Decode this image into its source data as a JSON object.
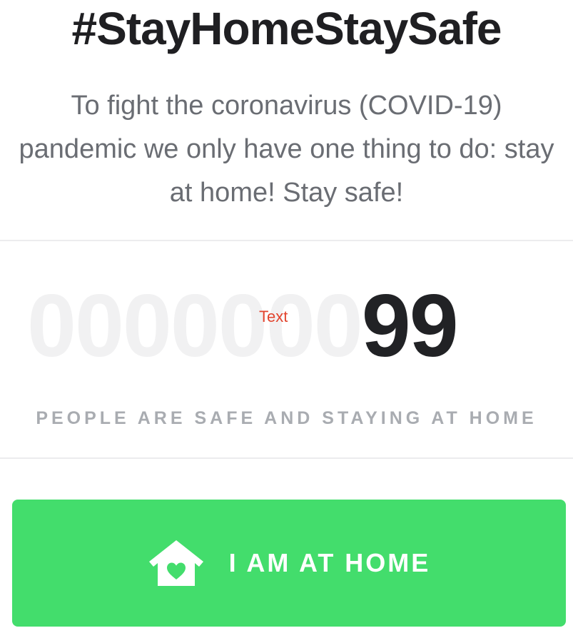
{
  "header": {
    "title": "#StayHomeStaySafe",
    "intro": "To fight the coronavirus (COVID-19) pandemic we only have one thing to do: stay at home! Stay safe!"
  },
  "counter": {
    "leading_zeros": "0000000",
    "value": "99",
    "placeholder": "Text"
  },
  "caption": "PEOPLE ARE SAFE AND STAYING AT HOME",
  "cta": {
    "label": "I AM AT HOME",
    "icon": "home-heart-icon"
  },
  "colors": {
    "accent": "#43dd6c",
    "placeholder_red": "#e2452f",
    "caption_gray": "#a9acb1",
    "ghost_digits": "#f1f1f2"
  }
}
